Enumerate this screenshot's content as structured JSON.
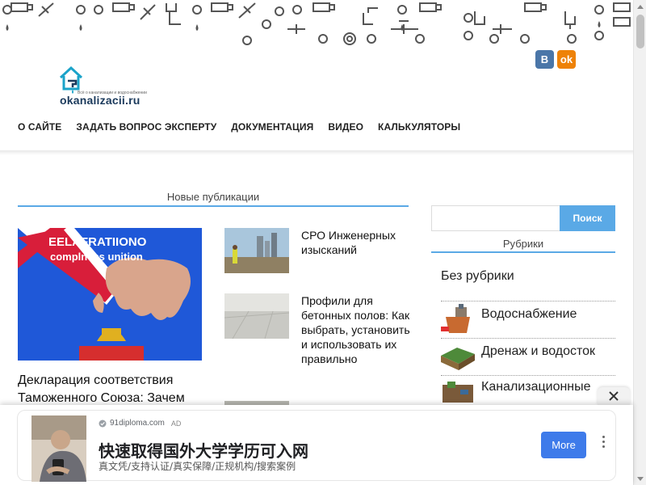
{
  "site": {
    "logo_text": "okanalizacii.ru",
    "logo_tagline": "Всё о канализации и водоснабжении",
    "social": [
      {
        "name": "vk",
        "glyph": "В"
      },
      {
        "name": "ok",
        "glyph": "ok"
      }
    ]
  },
  "nav": {
    "items": [
      {
        "label": "О САЙТЕ"
      },
      {
        "label": "ЗАДАТЬ ВОПРОС ЭКСПЕРТУ"
      },
      {
        "label": "ДОКУМЕНТАЦИЯ"
      },
      {
        "label": "ВИДЕО"
      },
      {
        "label": "КАЛЬКУЛЯТОРЫ"
      }
    ]
  },
  "main": {
    "section_title": "Новые публикации",
    "featured": {
      "image_text_1": "EELAFRATIIONO",
      "image_text_2": "complness unition",
      "title": "Декларация соответствия Таможенного Союза: Зачем"
    },
    "posts": [
      {
        "title": "СРО Инженерных изысканий"
      },
      {
        "title": "Профили для бетонных полов: Как выбрать, установить и использовать их правильно"
      }
    ]
  },
  "sidebar": {
    "search_placeholder": "",
    "search_button": "Поиск",
    "rubrics_title": "Рубрики",
    "categories": [
      {
        "label": "Без рубрики",
        "icon": "none"
      },
      {
        "label": "Водоснабжение",
        "icon": "water-supply-icon"
      },
      {
        "label": "Дренаж и водосток",
        "icon": "drainage-icon"
      },
      {
        "label": "Канализационные",
        "icon": "sewer-icon"
      }
    ]
  },
  "ad": {
    "domain": "91diploma.com",
    "badge": "AD",
    "headline": "快速取得国外大学学历可入网",
    "description": "真文凭/支持认证/真实保障/正规机构/搜索案例",
    "cta": "More",
    "colors": {
      "cta": "#3e7bea"
    }
  },
  "theme": {
    "accent": "#5aa9e6",
    "vk": "#4a76a8",
    "ok": "#ee8208"
  }
}
